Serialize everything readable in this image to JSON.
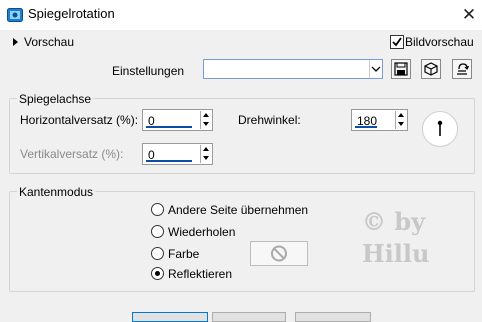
{
  "window": {
    "title": "Spiegelrotation",
    "close_glyph": "✕"
  },
  "preview": {
    "label": "Vorschau",
    "bildvorschau_label": "Bildvorschau",
    "bildvorschau_checked": true
  },
  "presets": {
    "label": "Einstellungen",
    "value": ""
  },
  "spiegelachse": {
    "title": "Spiegelachse",
    "horizontal_label": "Horizontalversatz (%):",
    "horizontal_value": "0",
    "vertikal_label": "Vertikalversatz (%):",
    "vertikal_value": "0",
    "drehwinkel_label": "Drehwinkel:",
    "drehwinkel_value": "180"
  },
  "kantenmodus": {
    "title": "Kantenmodus",
    "options": [
      {
        "label": "Andere Seite übernehmen",
        "selected": false
      },
      {
        "label": "Wiederholen",
        "selected": false
      },
      {
        "label": "Farbe",
        "selected": false
      },
      {
        "label": "Reflektieren",
        "selected": true
      }
    ]
  },
  "watermark": {
    "line1": "© by",
    "line2": "Hillu"
  },
  "colors": {
    "accent": "#0b4ea8",
    "ok_border": "#0078d7",
    "background": "#f0f0f0"
  },
  "icons": [
    "app-icon",
    "expand-arrow-icon",
    "checkmark-icon",
    "dropdown-arrow-icon",
    "save-icon",
    "cube-icon",
    "reset-icon",
    "no-color-icon"
  ]
}
